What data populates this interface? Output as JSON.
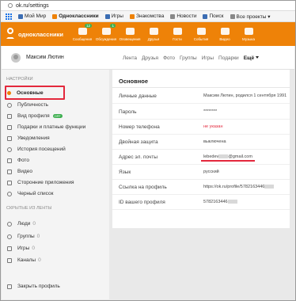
{
  "browser": {
    "url": "ok.ru/settings"
  },
  "bookmarks": [
    {
      "label": "Мой Мир",
      "icon": "mail-icon"
    },
    {
      "label": "Одноклассники",
      "icon": "ok-icon"
    },
    {
      "label": "Игры",
      "icon": "games-icon"
    },
    {
      "label": "Знакомства",
      "icon": "dating-icon"
    },
    {
      "label": "Новости",
      "icon": "news-icon"
    },
    {
      "label": "Поиск",
      "icon": "search-icon"
    },
    {
      "label": "Все проекты ▾",
      "icon": "projects-icon"
    }
  ],
  "toolbar": {
    "logo_text": "одноклассники",
    "buttons": [
      {
        "label": "Сообщения",
        "badge": "12",
        "icon": "messages-icon"
      },
      {
        "label": "Обсуждения",
        "badge": "1",
        "icon": "discussions-icon"
      },
      {
        "label": "Оповещения",
        "badge": "",
        "icon": "notifications-icon"
      },
      {
        "label": "Друзья",
        "badge": "",
        "icon": "friends-icon"
      },
      {
        "label": "Гости",
        "badge": "",
        "icon": "guests-icon"
      },
      {
        "label": "События",
        "badge": "",
        "icon": "events-icon"
      },
      {
        "label": "Видео",
        "badge": "",
        "icon": "video-icon"
      },
      {
        "label": "Музыка",
        "badge": "",
        "icon": "music-icon"
      }
    ],
    "accent": "#ee8208"
  },
  "profile": {
    "name": "Максим Лютин",
    "tabs": [
      "Лента",
      "Друзья",
      "Фото",
      "Группы",
      "Игры",
      "Подарки"
    ],
    "more": "Ещё"
  },
  "sidebar": {
    "section_settings": "НАСТРОЙКИ",
    "items": [
      {
        "label": "Основные",
        "icon": "gear-icon"
      },
      {
        "label": "Публичность",
        "icon": "public-icon"
      },
      {
        "label": "Вид профиля",
        "icon": "profile-view-icon",
        "badge": "OFF"
      },
      {
        "label": "Подарки и платные функции",
        "icon": "gift-icon"
      },
      {
        "label": "Уведомления",
        "icon": "bell-icon"
      },
      {
        "label": "История посещений",
        "icon": "history-icon"
      },
      {
        "label": "Фото",
        "icon": "photo-icon"
      },
      {
        "label": "Видео",
        "icon": "video-icon"
      },
      {
        "label": "Сторонние приложения",
        "icon": "apps-icon"
      },
      {
        "label": "Черный список",
        "icon": "blacklist-icon"
      }
    ],
    "section_hidden": "СКРЫТЫЕ ИЗ ЛЕНТЫ",
    "hidden": [
      {
        "label": "Люди",
        "count": "0",
        "icon": "people-icon"
      },
      {
        "label": "Группы",
        "count": "0",
        "icon": "groups-icon"
      },
      {
        "label": "Игры",
        "count": "0",
        "icon": "games-icon"
      },
      {
        "label": "Каналы",
        "count": "0",
        "icon": "channels-icon"
      }
    ],
    "close_profile": "Закрыть профиль"
  },
  "main": {
    "title": "Основное",
    "rows": [
      {
        "key": "Личные данные",
        "value": "Максим Лютин, родился 1 сентября 1991"
      },
      {
        "key": "Пароль",
        "value": "********"
      },
      {
        "key": "Номер телефона",
        "value": "не указан"
      },
      {
        "key": "Двойная защита",
        "value": "выключена"
      },
      {
        "key": "Адрес эл. почты",
        "value_prefix": "lebedev",
        "value_suffix": "@gmail.com"
      },
      {
        "key": "Язык",
        "value": "русский"
      },
      {
        "key": "Ссылка на профиль",
        "value": "https://ok.ru/profile/5782163446"
      },
      {
        "key": "ID вашего профиля",
        "value": "5782163446"
      }
    ]
  }
}
